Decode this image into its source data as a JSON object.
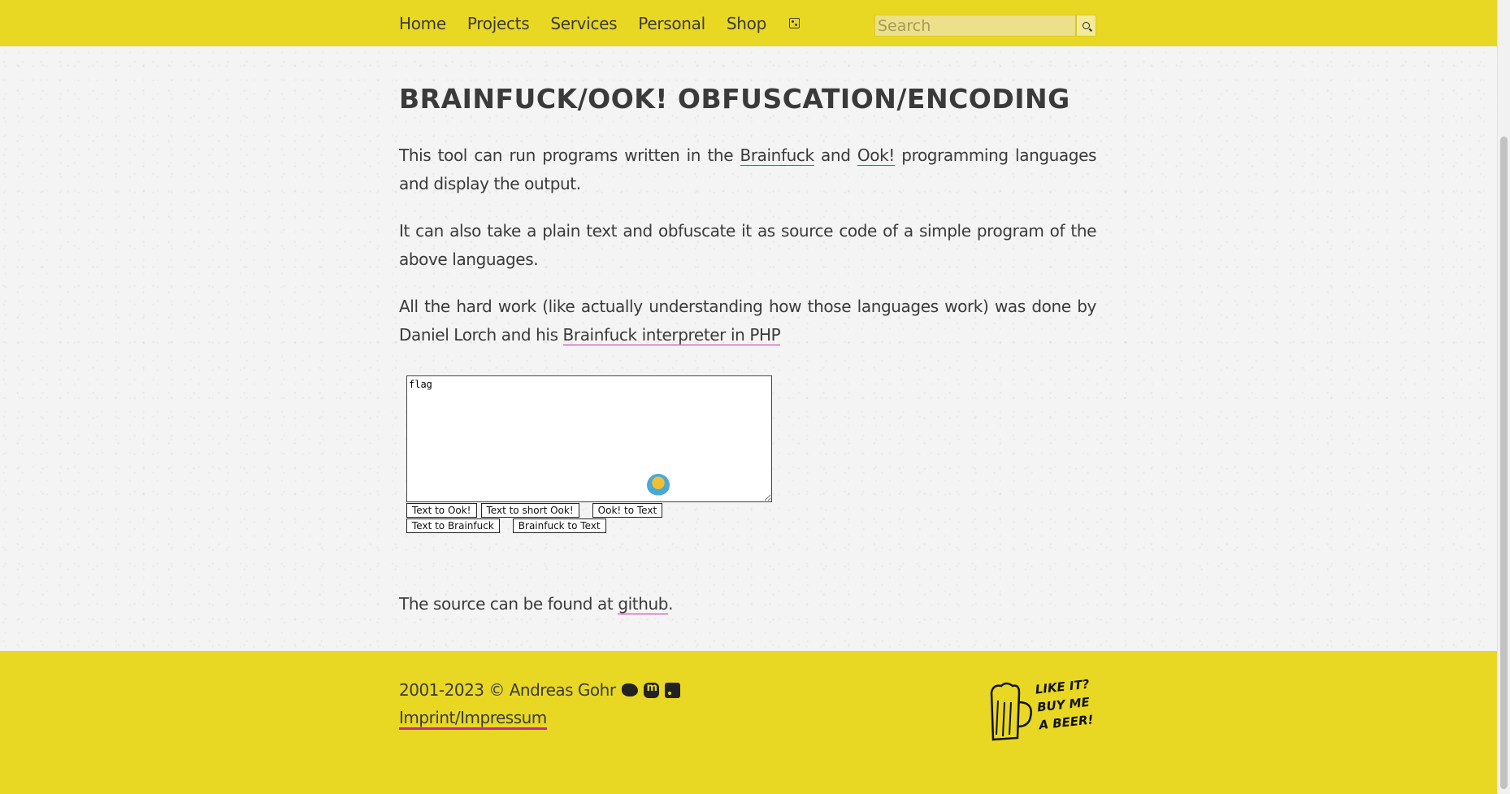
{
  "nav": {
    "items": [
      {
        "label": "Home"
      },
      {
        "label": "Projects"
      },
      {
        "label": "Services"
      },
      {
        "label": "Personal"
      },
      {
        "label": "Shop"
      }
    ],
    "random_icon": "dice-icon"
  },
  "search": {
    "placeholder": "Search",
    "button_icon": "search-icon"
  },
  "main": {
    "title": "Brainfuck/Ook! Obfuscation/Encoding",
    "p1": {
      "before": "This tool can run programs written in the ",
      "link1": "Brainfuck",
      "middle": " and ",
      "link2": "Ook!",
      "after": " programming languages and display the output."
    },
    "p2": "It can also take a plain text and obfuscate it as source code of a simple program of the above languages.",
    "p3": {
      "before": "All the hard work (like actually understanding how those languages work) was done by Daniel Lorch and his ",
      "link": "Brainfuck interpreter in PHP"
    },
    "tool": {
      "textarea_value": "flag",
      "buttons_row1": [
        "Text to Ook!",
        "Text to short Ook!",
        "Ook! to Text"
      ],
      "buttons_row2": [
        "Text to Brainfuck",
        "Brainfuck to Text"
      ]
    },
    "p4": {
      "before": "The source can be found at ",
      "link": "github",
      "after": "."
    }
  },
  "footer": {
    "copyright": "2001-2023 © Andreas Gohr",
    "social_icons": [
      "twitter-icon",
      "mastodon-icon",
      "rss-icon"
    ],
    "imprint": "Imprint/Impressum",
    "beer_text": "LIKE IT?\nBUY ME\nA BEER!"
  },
  "colors": {
    "header_bg": "#e9d823",
    "link_underline": "#c6289a"
  }
}
